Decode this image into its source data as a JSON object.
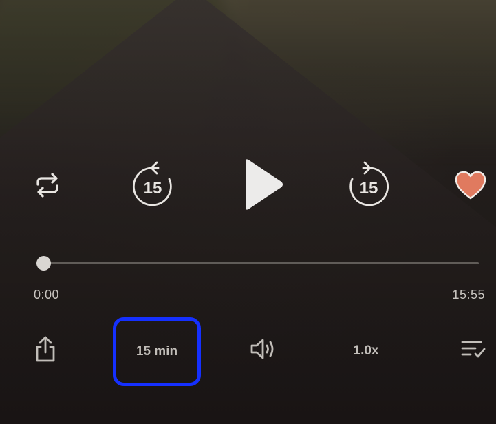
{
  "player": {
    "controls": {
      "repeat_icon": "repeat-icon",
      "rewind_label": "15",
      "play_icon": "play-icon",
      "forward_label": "15",
      "favorite_icon": "heart-icon",
      "favorite_color": "#e07a5f"
    },
    "progress": {
      "current_time": "0:00",
      "total_time": "15:55",
      "fraction": 0.0
    },
    "bottom_bar": {
      "share_icon": "share-icon",
      "sleep_timer_label": "15 min",
      "volume_icon": "speaker-icon",
      "speed_label": "1.0x",
      "queue_icon": "queue-list-icon"
    },
    "highlight_color": "#1530ff"
  }
}
